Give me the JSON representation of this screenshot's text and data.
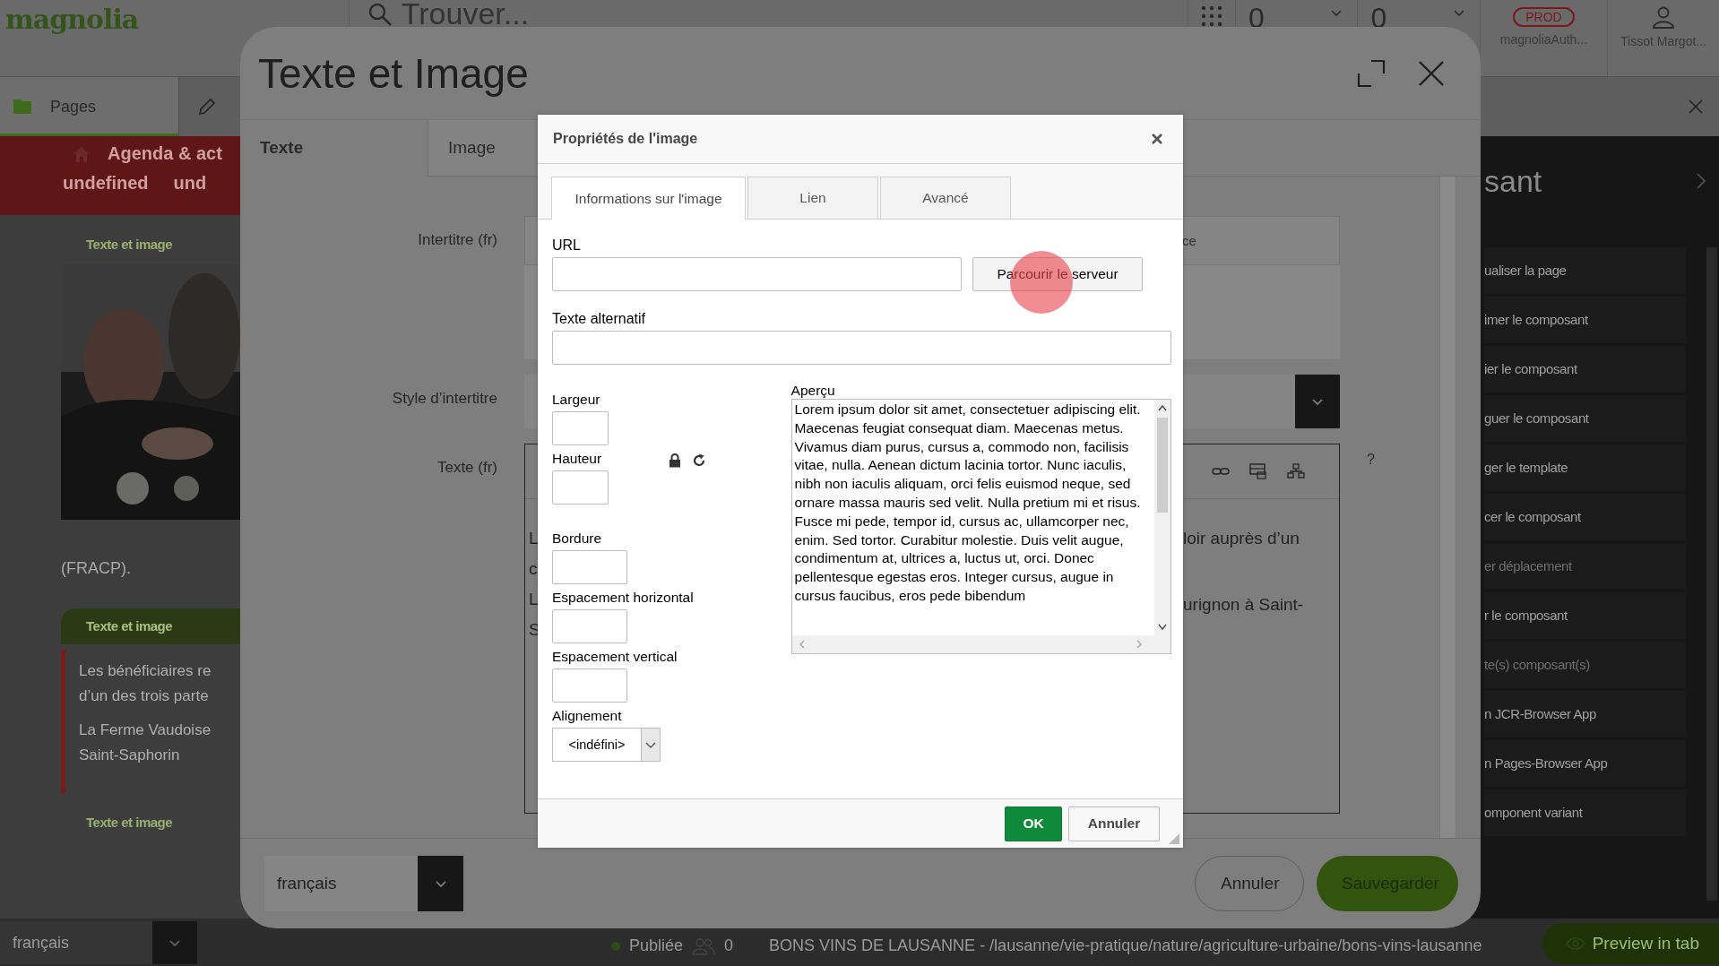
{
  "app_bar": {
    "logo": "magnolia",
    "search_placeholder": "Trouver...",
    "counters": [
      "0",
      "0"
    ],
    "environment": "PROD",
    "instance": "magnoliaAuth...",
    "user": "Tissot Margot..."
  },
  "app_tabs": [
    {
      "label": "Pages",
      "selected": true
    }
  ],
  "page_preview": {
    "breadcrumb": "Agenda & act",
    "nav": [
      "undefined",
      "und"
    ],
    "blocks": [
      {
        "kind": "label",
        "text": "Texte et image"
      },
      {
        "kind": "picture"
      },
      {
        "kind": "text",
        "text": "(FRACP)."
      },
      {
        "kind": "bar",
        "text": "Texte et image"
      },
      {
        "kind": "quote",
        "paragraphs": [
          "Les bénéficiaires re\nd’un des trois parte",
          "La Ferme Vaudoise\nSaint-Saphorin"
        ]
      },
      {
        "kind": "label",
        "text": "Texte et image"
      }
    ]
  },
  "actions_panel": {
    "title": "sant",
    "items": [
      {
        "label": "ualiser la page",
        "disabled": false
      },
      {
        "label": "imer le composant",
        "disabled": false
      },
      {
        "label": "ier le composant",
        "disabled": false
      },
      {
        "label": "guer le composant",
        "disabled": false
      },
      {
        "label": "ger le template",
        "disabled": false
      },
      {
        "label": "cer le composant",
        "disabled": false
      },
      {
        "label": "er déplacement",
        "disabled": true
      },
      {
        "label": "r le composant",
        "disabled": false
      },
      {
        "label": "te(s) composant(s)",
        "disabled": true
      },
      {
        "label": "n JCR-Browser App",
        "disabled": false
      },
      {
        "label": "n Pages-Browser App",
        "disabled": false
      },
      {
        "label": "omponent variant",
        "disabled": false
      }
    ]
  },
  "status_bar": {
    "language": "français",
    "status": "Publiée",
    "subscribers": "0",
    "path": "BONS VINS DE LAUSANNE - /lausanne/vie-pratique/nature/agriculture-urbaine/bons-vins-lausanne",
    "preview_button": "Preview in tab"
  },
  "dialog": {
    "title": "Texte et Image",
    "tabs": [
      {
        "label": "Texte",
        "selected": true
      },
      {
        "label": "Image",
        "selected": false
      }
    ],
    "subtitle_label": "Intertitre (fr)",
    "subtitle_value": "ce",
    "style_label": "Style d’intertitre",
    "text_label": "Texte (fr)",
    "help": "?",
    "editor_left": [
      "L",
      "c",
      "L",
      "S"
    ],
    "editor_right": [
      "loir auprès d’un",
      "urignon à Saint-"
    ],
    "language": "français",
    "buttons": [
      {
        "label": "Annuler",
        "kind": "secondary"
      },
      {
        "label": "Sauvegarder",
        "kind": "primary"
      }
    ]
  },
  "image_dialog": {
    "title": "Propriétés de l'image",
    "tabs": [
      {
        "label": "Informations sur l'image",
        "selected": true
      },
      {
        "label": "Lien",
        "selected": false
      },
      {
        "label": "Avancé",
        "selected": false
      }
    ],
    "url_label": "URL",
    "browse_button": "Parcourir le serveur",
    "alt_label": "Texte alternatif",
    "width_label": "Largeur",
    "height_label": "Hauteur",
    "border_label": "Bordure",
    "hspace_label": "Espacement horizontal",
    "vspace_label": "Espacement vertical",
    "align_label": "Alignement",
    "align_value": "<indéfini>",
    "preview_label": "Aperçu",
    "preview_text": "Lorem ipsum dolor sit amet, consectetuer adipiscing elit. Maecenas feugiat consequat diam. Maecenas metus. Vivamus diam purus, cursus a, commodo non, facilisis vitae, nulla. Aenean dictum lacinia tortor. Nunc iaculis, nibh non iaculis aliquam, orci felis euismod neque, sed ornare massa mauris sed velit. Nulla pretium mi et risus. Fusce mi pede, tempor id, cursus ac, ullamcorper nec, enim. Sed tortor. Curabitur molestie. Duis velit augue, condimentum at, ultrices a, luctus ut, orci. Donec pellentesque egestas eros. Integer cursus, augue in cursus faucibus, eros pede bibendum",
    "buttons": [
      {
        "label": "OK",
        "kind": "primary"
      },
      {
        "label": "Annuler",
        "kind": "secondary"
      }
    ]
  }
}
